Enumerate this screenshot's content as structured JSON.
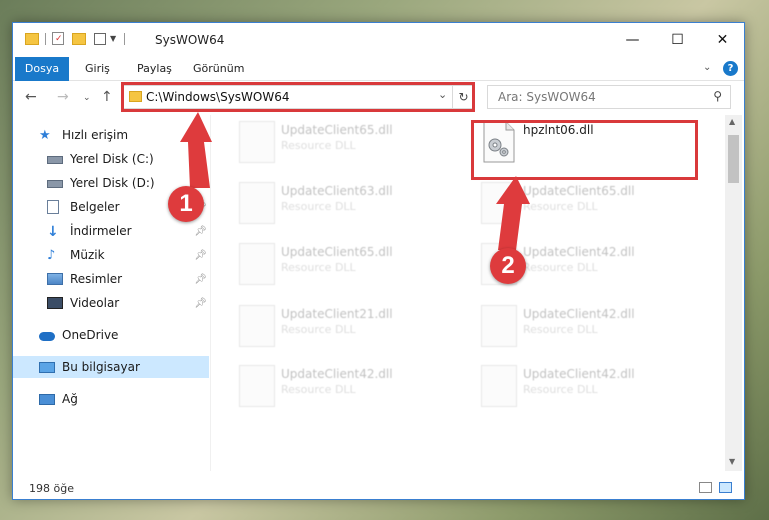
{
  "window": {
    "title": "SysWOW64",
    "controls": {
      "minimize": "—",
      "maximize": "☐",
      "close": "✕"
    }
  },
  "ribbon": {
    "tabs": [
      "Dosya",
      "Giriş",
      "Paylaş",
      "Görünüm"
    ],
    "help": "?"
  },
  "address": {
    "path": "C:\\Windows\\SysWOW64",
    "search_placeholder": "Ara: SysWOW64"
  },
  "sidebar": {
    "items": [
      {
        "label": "Hızlı erişim",
        "icon": "star-icon",
        "pinned": false
      },
      {
        "label": "Yerel Disk (C:)",
        "icon": "drive-icon",
        "pinned": false
      },
      {
        "label": "Yerel Disk (D:)",
        "icon": "drive-icon",
        "pinned": false
      },
      {
        "label": "Belgeler",
        "icon": "document-icon",
        "pinned": true
      },
      {
        "label": "İndirmeler",
        "icon": "download-icon",
        "pinned": true
      },
      {
        "label": "Müzik",
        "icon": "music-icon",
        "pinned": true
      },
      {
        "label": "Resimler",
        "icon": "pictures-icon",
        "pinned": true
      },
      {
        "label": "Videolar",
        "icon": "video-icon",
        "pinned": true
      },
      {
        "label": "OneDrive",
        "icon": "cloud-icon",
        "pinned": false
      },
      {
        "label": "Bu bilgisayar",
        "icon": "computer-icon",
        "pinned": false
      },
      {
        "label": "Ağ",
        "icon": "network-icon",
        "pinned": false
      }
    ]
  },
  "files": [
    {
      "name": "UpdateClient65.dll",
      "type": "Resource DLL"
    },
    {
      "name": "hpzlnt06.dll",
      "type": ""
    },
    {
      "name": "UpdateClient63.dll",
      "type": "Resource DLL"
    },
    {
      "name": "UpdateClient65.dll",
      "type": "Resource DLL"
    },
    {
      "name": "UpdateClient65.dll",
      "type": "Resource DLL"
    },
    {
      "name": "UpdateClient42.dll",
      "type": "Resource DLL"
    },
    {
      "name": "UpdateClient21.dll",
      "type": "Resource DLL"
    },
    {
      "name": "UpdateClient42.dll",
      "type": "Resource DLL"
    },
    {
      "name": "UpdateClient42.dll",
      "type": "Resource DLL"
    },
    {
      "name": "UpdateClient42.dll",
      "type": "Resource DLL"
    }
  ],
  "status": {
    "count": "198 öğe"
  },
  "annotations": {
    "step1": "1",
    "step2": "2",
    "color": "#d9393b"
  }
}
